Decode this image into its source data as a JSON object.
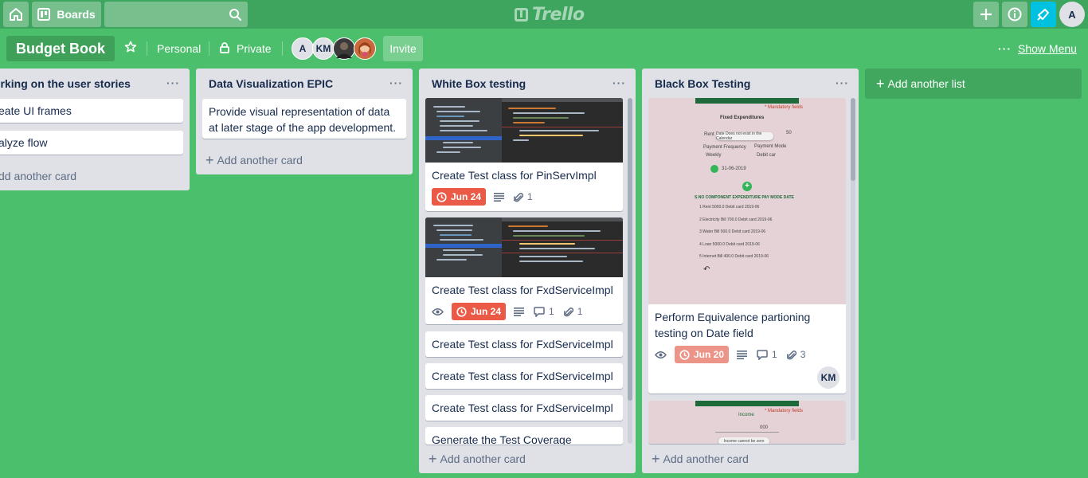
{
  "header": {
    "boards_label": "Boards",
    "logo_text": "Trello",
    "user_initial": "A"
  },
  "board": {
    "title": "Budget Book",
    "team": "Personal",
    "visibility": "Private",
    "members": [
      "A",
      "KM"
    ],
    "invite_label": "Invite",
    "show_menu_label": "Show Menu"
  },
  "lists": [
    {
      "title": "orking on the user stories",
      "cards": [
        {
          "title": "eate UI frames"
        },
        {
          "title": "alyze flow"
        }
      ],
      "add_card_label": "dd another card"
    },
    {
      "title": "Data Visualization EPIC",
      "cards": [
        {
          "title": "Provide visual representation of data at later stage of the app development."
        }
      ],
      "add_card_label": "Add another card"
    },
    {
      "title": "White Box testing",
      "cards": [
        {
          "title": "Create Test class for PinServImpl",
          "due": "Jun 24",
          "attachments": "1"
        },
        {
          "title": "Create Test class for FxdServiceImpl",
          "due": "Jun 24",
          "comments": "1",
          "attachments": "1"
        },
        {
          "title": "Create Test class for FxdServiceImpl"
        },
        {
          "title": "Create Test class for FxdServiceImpl"
        },
        {
          "title": "Create Test class for FxdServiceImpl"
        },
        {
          "title": "Generate the Test Coverage"
        }
      ],
      "add_card_label": "Add another card"
    },
    {
      "title": "Black Box Testing",
      "cards": [
        {
          "title": "Perform Equivalence partioning testing on Date field",
          "due": "Jun 20",
          "comments": "1",
          "attachments": "3",
          "member": "KM",
          "cover": {
            "mandatory": "* Mandatory fields",
            "screen_title": "Fixed Expenditures",
            "toast": "Date Does not exist in the Calendar",
            "amount_label": "Rent",
            "amount_value": "50",
            "freq_label": "Payment Frequency",
            "mode_label": "Payment Mode",
            "freq_value": "Weekly",
            "mode_value": "Debit car",
            "date_value": "31-06-2019",
            "table_header": "S.NO   COMPONENT   EXPENDITURE   PAY MODE   DATE",
            "rows": [
              "1        Rent            5000.0      Debit card   2019-06",
              "2    Electricity Bill       700.0      Debit card   2019-06",
              "3      Water Bill           500.0      Debit card   2019-06",
              "4         Loan            5000.0      Debit card   2019-06",
              "5     Internet Bill        400.0      Debit card   2019-06"
            ]
          }
        },
        {
          "title": "",
          "cover": {
            "screen_title": "Income",
            "mandatory": "* Mandatory fields",
            "amount_value": "000",
            "toast": "Income cannot be zero"
          }
        }
      ],
      "add_card_label": "Add another card"
    }
  ],
  "add_list_label": "Add another list",
  "colors": {
    "board_bg": "#4bbf6b",
    "header_bg": "#3da55e",
    "overdue_red": "#eb5a46",
    "due_soon_pink": "#ec9488",
    "list_bg": "#dfe1e6"
  }
}
